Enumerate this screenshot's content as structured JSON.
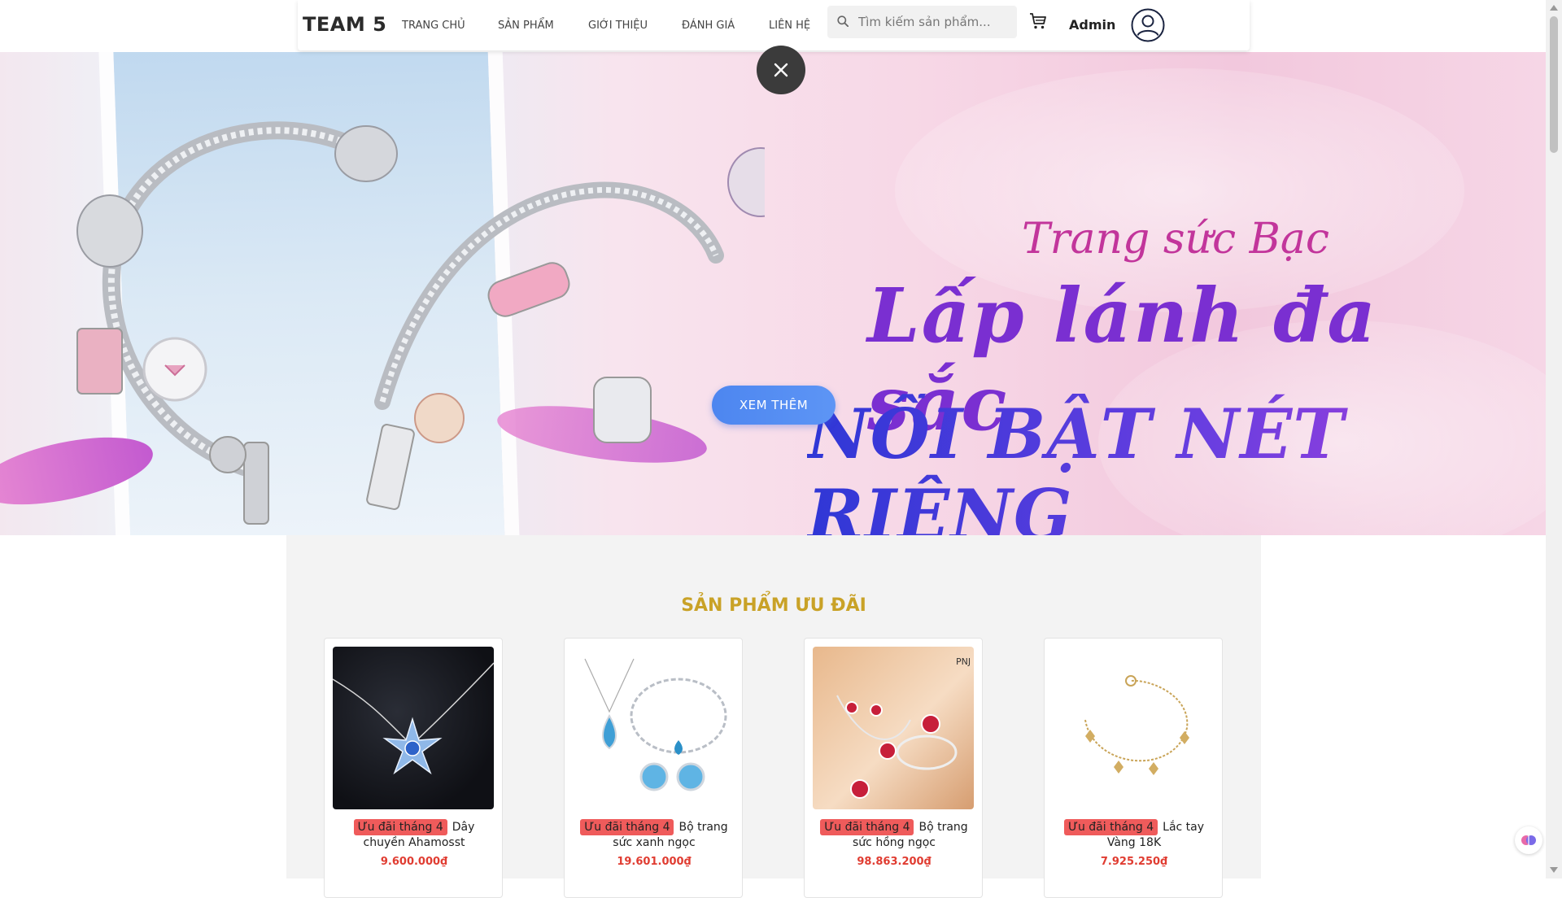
{
  "header": {
    "brand": "TEAM 5",
    "nav": [
      {
        "label": "TRANG CHỦ"
      },
      {
        "label": "SẢN PHẨM"
      },
      {
        "label": "GIỚI THIỆU"
      },
      {
        "label": "ĐÁNH GIÁ"
      },
      {
        "label": "LIÊN HỆ"
      }
    ],
    "search_placeholder": "Tìm kiếm sản phẩm...",
    "user_name": "Admin",
    "icons": [
      "search-icon",
      "cart-icon",
      "user-avatar-icon"
    ]
  },
  "banner": {
    "title_line1": "Trang sức Bạc",
    "title_line2": "Lấp lánh đa sắc",
    "title_line3": "NỔI BẬT NÉT RIÊNG",
    "button_label": "XEM THÊM",
    "close_icon": "close-icon"
  },
  "section": {
    "title": "SẢN PHẨM ƯU ĐÃI",
    "products": [
      {
        "badge": "Ưu đãi tháng 4",
        "name": "Dây chuyền Ahamosst",
        "price": "9.600.000₫"
      },
      {
        "badge": "Ưu đãi tháng 4",
        "name": "Bộ trang sức xanh ngọc",
        "price": "19.601.000₫"
      },
      {
        "badge": "Ưu đãi tháng 4",
        "name": "Bộ trang sức hồng ngọc",
        "price": "98.863.200₫"
      },
      {
        "badge": "Ưu đãi tháng 4",
        "name": "Lắc tay Vàng 18K",
        "price": "7.925.250₫"
      }
    ],
    "image_watermark": "PNJ"
  },
  "colors": {
    "accent_title": "#c9a227",
    "price": "#e03c31",
    "badge": "#ef5b5b",
    "button": "#4d86f0"
  }
}
